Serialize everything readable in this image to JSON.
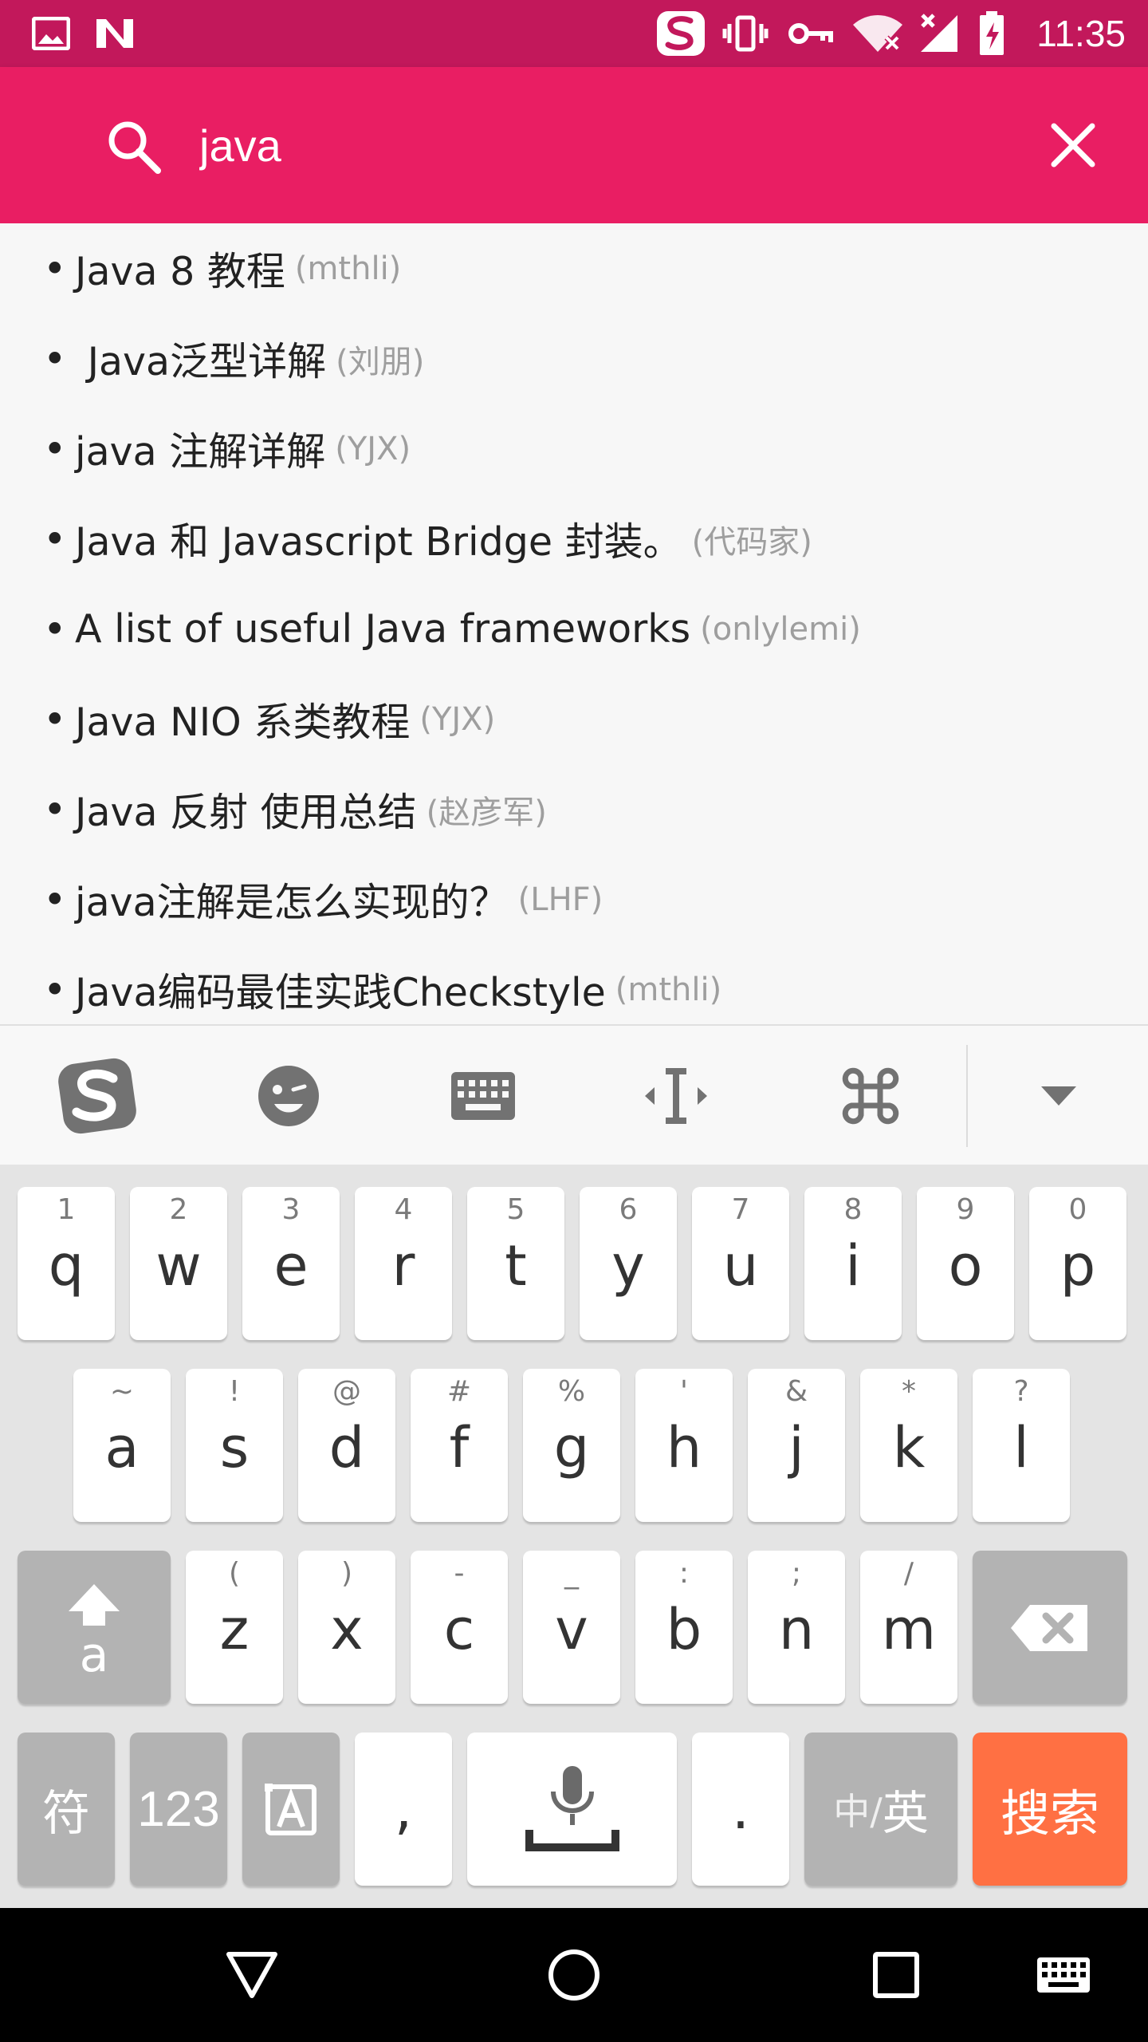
{
  "status_bar": {
    "time": "11:35",
    "icons": [
      "image-notification-icon",
      "n-notification-icon",
      "sogou-ime-icon",
      "vibrate-icon",
      "vpn-key-icon",
      "wifi-off-icon",
      "no-signal-icon",
      "battery-charging-icon"
    ]
  },
  "search": {
    "query": "java",
    "placeholder": "",
    "search_icon": "search-icon",
    "clear_icon": "close-icon"
  },
  "results": [
    {
      "title": "Java 8 教程",
      "author": "(mthli)"
    },
    {
      "title": " Java泛型详解",
      "author": "(刘朋)"
    },
    {
      "title": "java 注解详解",
      "author": "(YJX)"
    },
    {
      "title": "Java 和 Javascript Bridge 封装。",
      "author": "(代码家)"
    },
    {
      "title": "A list of useful Java frameworks",
      "author": "(onlylemi)"
    },
    {
      "title": "Java NIO 系类教程",
      "author": "(YJX)"
    },
    {
      "title": "Java 反射 使用总结",
      "author": "(赵彦军)"
    },
    {
      "title": "java注解是怎么实现的？",
      "author": "(LHF)"
    },
    {
      "title": "Java编码最佳实践Checkstyle",
      "author": "(mthli)"
    }
  ],
  "keyboard": {
    "toolbar_icons": [
      "sogou-logo-icon",
      "emoji-icon",
      "keyboard-icon",
      "cursor-icon",
      "command-icon",
      "collapse-arrow-icon"
    ],
    "row1": [
      {
        "hint": "1",
        "key": "q"
      },
      {
        "hint": "2",
        "key": "w"
      },
      {
        "hint": "3",
        "key": "e"
      },
      {
        "hint": "4",
        "key": "r"
      },
      {
        "hint": "5",
        "key": "t"
      },
      {
        "hint": "6",
        "key": "y"
      },
      {
        "hint": "7",
        "key": "u"
      },
      {
        "hint": "8",
        "key": "i"
      },
      {
        "hint": "9",
        "key": "o"
      },
      {
        "hint": "0",
        "key": "p"
      }
    ],
    "row2": [
      {
        "hint": "~",
        "key": "a"
      },
      {
        "hint": "!",
        "key": "s"
      },
      {
        "hint": "@",
        "key": "d"
      },
      {
        "hint": "#",
        "key": "f"
      },
      {
        "hint": "%",
        "key": "g"
      },
      {
        "hint": "'",
        "key": "h"
      },
      {
        "hint": "&",
        "key": "j"
      },
      {
        "hint": "*",
        "key": "k"
      },
      {
        "hint": "?",
        "key": "l"
      }
    ],
    "row3": [
      {
        "hint": "(",
        "key": "z"
      },
      {
        "hint": ")",
        "key": "x"
      },
      {
        "hint": "-",
        "key": "c"
      },
      {
        "hint": "_",
        "key": "v"
      },
      {
        "hint": ":",
        "key": "b"
      },
      {
        "hint": ";",
        "key": "n"
      },
      {
        "hint": "/",
        "key": "m"
      }
    ],
    "shift_key": "a",
    "symbols_key": "符",
    "numbers_key": "123",
    "comma_key": ",",
    "period_key": ".",
    "lang_key_a": "中/",
    "lang_key_b": "英",
    "search_key": "搜索",
    "accent_color": "#ff7043"
  },
  "colors": {
    "status_bar": "#c2185b",
    "toolbar": "#e91e63"
  }
}
